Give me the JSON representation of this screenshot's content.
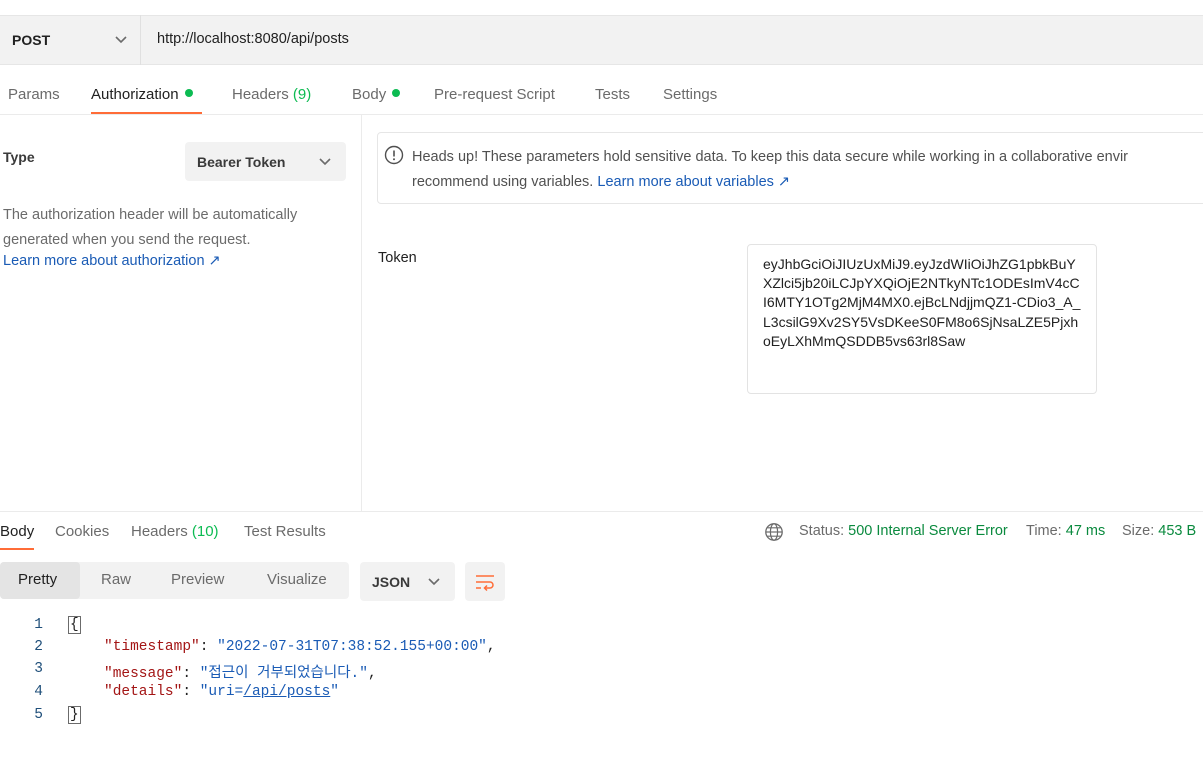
{
  "request": {
    "method": "POST",
    "url": "http://localhost:8080/api/posts"
  },
  "request_tabs": [
    {
      "label": "Params"
    },
    {
      "label": "Authorization",
      "dot": true
    },
    {
      "label": "Headers",
      "count": "(9)"
    },
    {
      "label": "Body",
      "dot": true
    },
    {
      "label": "Pre-request Script"
    },
    {
      "label": "Tests"
    },
    {
      "label": "Settings"
    }
  ],
  "auth": {
    "type_label": "Type",
    "type_value": "Bearer Token",
    "description": "The authorization header will be automatically generated when you send the request.",
    "learn_more": "Learn more about authorization ↗",
    "alert_line1": "Heads up! These parameters hold sensitive data. To keep this data secure while working in a collaborative envir",
    "alert_line2": "recommend using variables.",
    "alert_link": "Learn more about variables ↗",
    "token_label": "Token",
    "token_value": "eyJhbGciOiJIUzUxMiJ9.eyJzdWIiOiJhZG1pbkBuYXZlci5jb20iLCJpYXQiOjE2NTkyNTc1ODEsImV4cCI6MTY1OTg2MjM4MX0.ejBcLNdjjmQZ1-CDio3_A_L3csilG9Xv2SY5VsDKeeS0FM8o6SjNsaLZE5PjxhoEyLXhMmQSDDB5vs63rl8Saw"
  },
  "response_tabs": [
    {
      "label": "Body"
    },
    {
      "label": "Cookies"
    },
    {
      "label": "Headers",
      "count": "(10)"
    },
    {
      "label": "Test Results"
    }
  ],
  "response_status": {
    "status_label": "Status:",
    "status_value": "500 Internal Server Error",
    "time_label": "Time:",
    "time_value": "47 ms",
    "size_label": "Size:",
    "size_value": "453 B"
  },
  "view_modes": [
    "Pretty",
    "Raw",
    "Preview",
    "Visualize"
  ],
  "format": "JSON",
  "body_lines": {
    "numbers": [
      "1",
      "2",
      "3",
      "4",
      "5"
    ],
    "open": "{",
    "close": "}",
    "k1": "\"timestamp\"",
    "v1": "\"2022-07-31T07:38:52.155+00:00\"",
    "k2": "\"message\"",
    "v2": "\"접근이 거부되었습니다.\"",
    "k3": "\"details\"",
    "v3_prefix": "\"uri=",
    "v3_link": "/api/posts",
    "v3_suffix": "\""
  },
  "colors": {
    "accent": "#ff6c37",
    "success": "#0cbb52",
    "link": "#1a5bb5"
  }
}
